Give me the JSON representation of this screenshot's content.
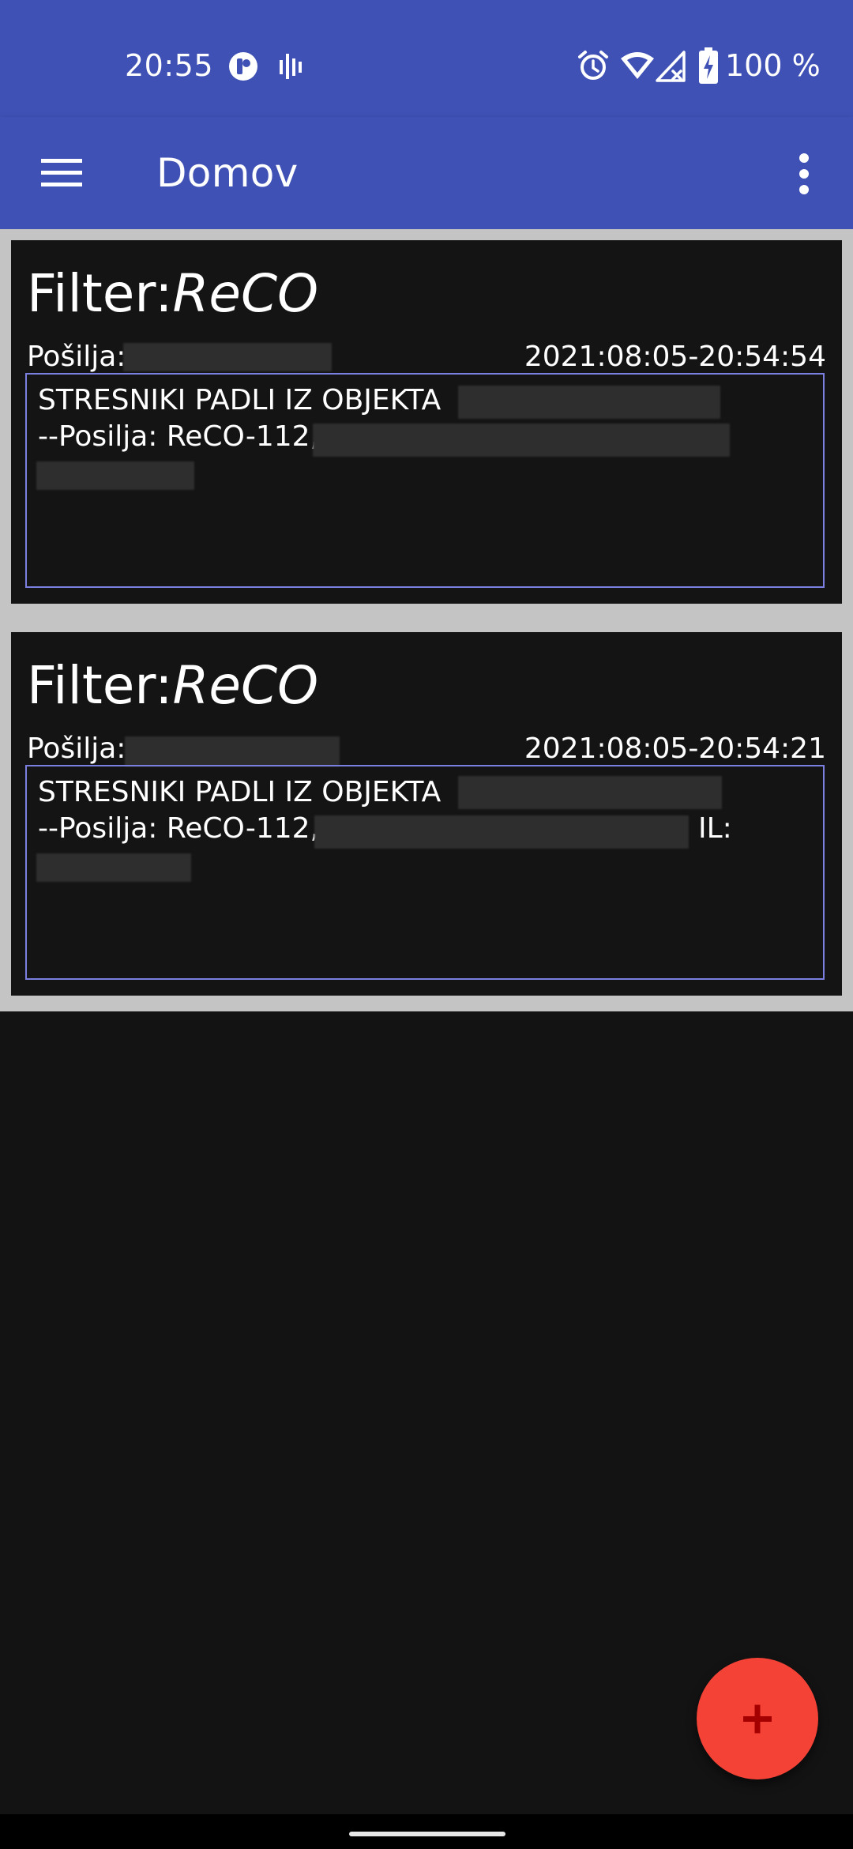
{
  "status_bar": {
    "time": "20:55",
    "battery": "100 %",
    "icons": [
      "notification-app-icon",
      "notification-bars-icon",
      "alarm-icon",
      "wifi-icon",
      "cell-signal-icon",
      "battery-charging-icon"
    ]
  },
  "app_bar": {
    "title": "Domov",
    "menu_icon": "hamburger-menu-icon",
    "overflow_icon": "more-vert-icon"
  },
  "cards": [
    {
      "filter_label": "Filter:",
      "filter_value": "ReCO",
      "sender_label": "Pošilja:",
      "timestamp": "2021:08:05-20:54:54",
      "message_line1": "STRESNIKI PADLI IZ OBJEKTA",
      "message_line2": "--Posilja: ReCO-112,",
      "message_line2_suffix": ""
    },
    {
      "filter_label": "Filter:",
      "filter_value": "ReCO",
      "sender_label": "Pošilja:",
      "timestamp": "2021:08:05-20:54:21",
      "message_line1": "STRESNIKI PADLI IZ OBJEKTA",
      "message_line2": "--Posilja: ReCO-112,",
      "message_line2_suffix": "IL:"
    }
  ],
  "fab": {
    "icon": "plus-icon"
  },
  "colors": {
    "primary": "#3f51b5",
    "accent": "#f44336",
    "card_border": "#7b7fe0",
    "background": "#131313"
  }
}
